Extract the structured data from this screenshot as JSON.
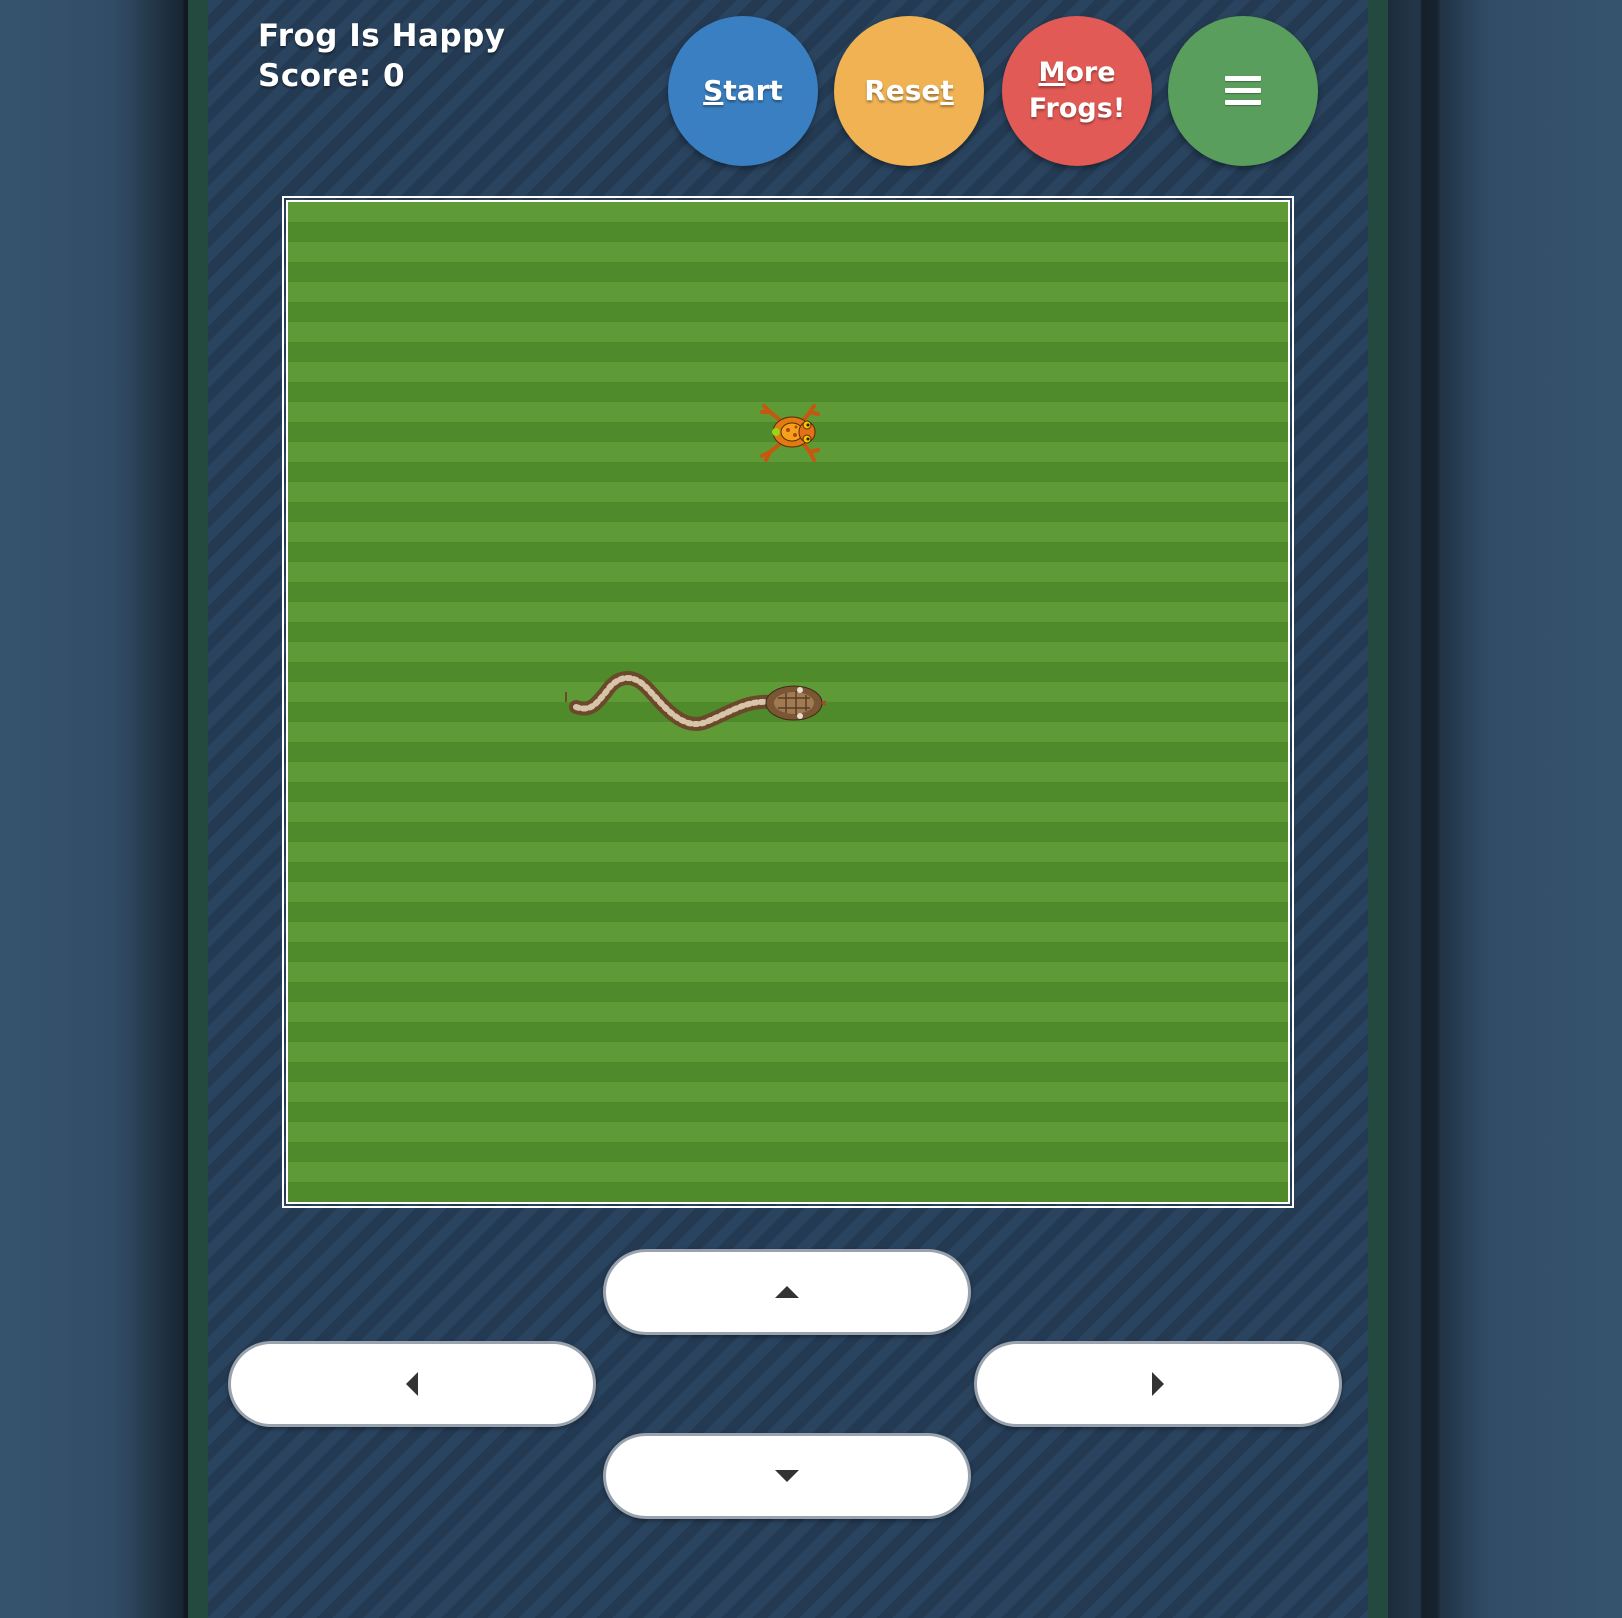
{
  "status": {
    "frog_mood": "Frog Is Happy",
    "score_label": "Score:",
    "score_value": "0"
  },
  "buttons": {
    "start": {
      "hotkey": "S",
      "rest": "tart"
    },
    "reset": {
      "prefix": "Rese",
      "hotkey": "t"
    },
    "more_frogs": {
      "hotkey": "M",
      "rest_line1": "ore",
      "line2": "Frogs!"
    },
    "menu_icon": "hamburger-menu-icon"
  },
  "field": {
    "frog_icon": "frog-sprite",
    "snake_icon": "snake-sprite",
    "colors": {
      "grass_light": "#5e9b36",
      "grass_dark": "#4f8a2b",
      "border": "#ffffff"
    }
  },
  "controls": {
    "up_icon": "arrow-up-icon",
    "left_icon": "arrow-left-icon",
    "right_icon": "arrow-right-icon",
    "down_icon": "arrow-down-icon"
  },
  "colors": {
    "start": "#3a7fc1",
    "reset": "#f0b252",
    "more_frogs": "#e15a55",
    "menu": "#5a9e5d",
    "panel": "#27405a",
    "panel_border": "#244a3f"
  }
}
